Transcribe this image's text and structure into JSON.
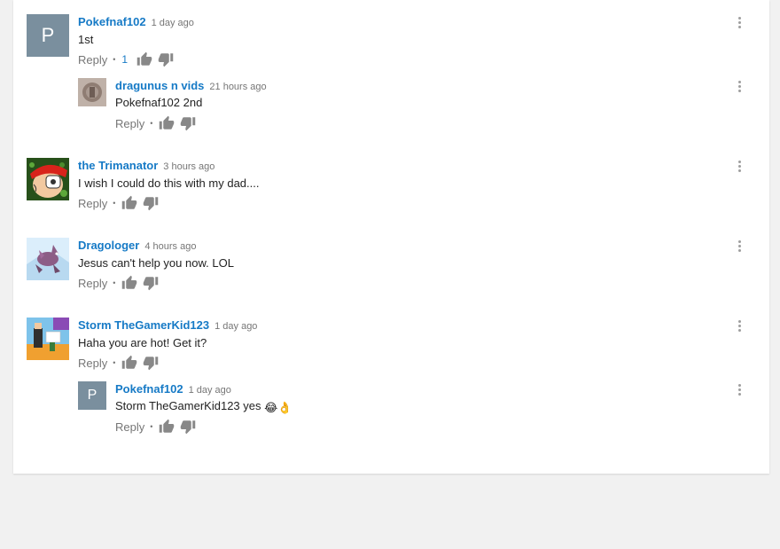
{
  "colors": {
    "author": "#167ac6",
    "text": "#222222",
    "muted": "#767676",
    "avatar_letter_bg": "#7a8f9e"
  },
  "reply_label": "Reply",
  "comments": [
    {
      "author": "Pokefnaf102",
      "time": "1 day ago",
      "text": "1st",
      "likes": "1",
      "avatar_letter": "P"
    },
    {
      "author": "dragunus n vids",
      "time": "21 hours ago",
      "text": "Pokefnaf102 2nd",
      "likes": ""
    },
    {
      "author": "the Trimanator",
      "time": "3 hours ago",
      "text": "I wish I could do this with my dad....",
      "likes": ""
    },
    {
      "author": "Dragologer",
      "time": "4 hours ago",
      "text": "Jesus can't help you now. LOL",
      "likes": ""
    },
    {
      "author": "Storm TheGamerKid123",
      "time": "1 day ago",
      "text": "Haha you are hot! Get it?",
      "likes": ""
    },
    {
      "author": "Pokefnaf102",
      "time": "1 day ago",
      "text": "Storm TheGamerKid123 yes",
      "emoji": "😂👌",
      "likes": "",
      "avatar_letter": "P"
    }
  ],
  "icons": {
    "like": "thumbs-up-icon",
    "dislike": "thumbs-down-icon",
    "menu": "more-vert-icon"
  }
}
